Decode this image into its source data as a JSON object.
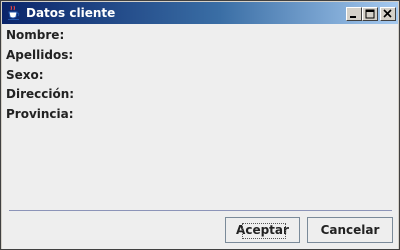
{
  "window": {
    "title": "Datos cliente",
    "icon": "java-cup-icon",
    "controls": [
      "minimize-icon",
      "maximize-icon",
      "close-icon"
    ]
  },
  "form": {
    "fields": [
      {
        "label": "Nombre:"
      },
      {
        "label": "Apellidos:"
      },
      {
        "label": "Sexo:"
      },
      {
        "label": "Dirección:"
      },
      {
        "label": "Provincia:"
      }
    ]
  },
  "buttons": {
    "accept": "Aceptar",
    "cancel": "Cancelar"
  }
}
